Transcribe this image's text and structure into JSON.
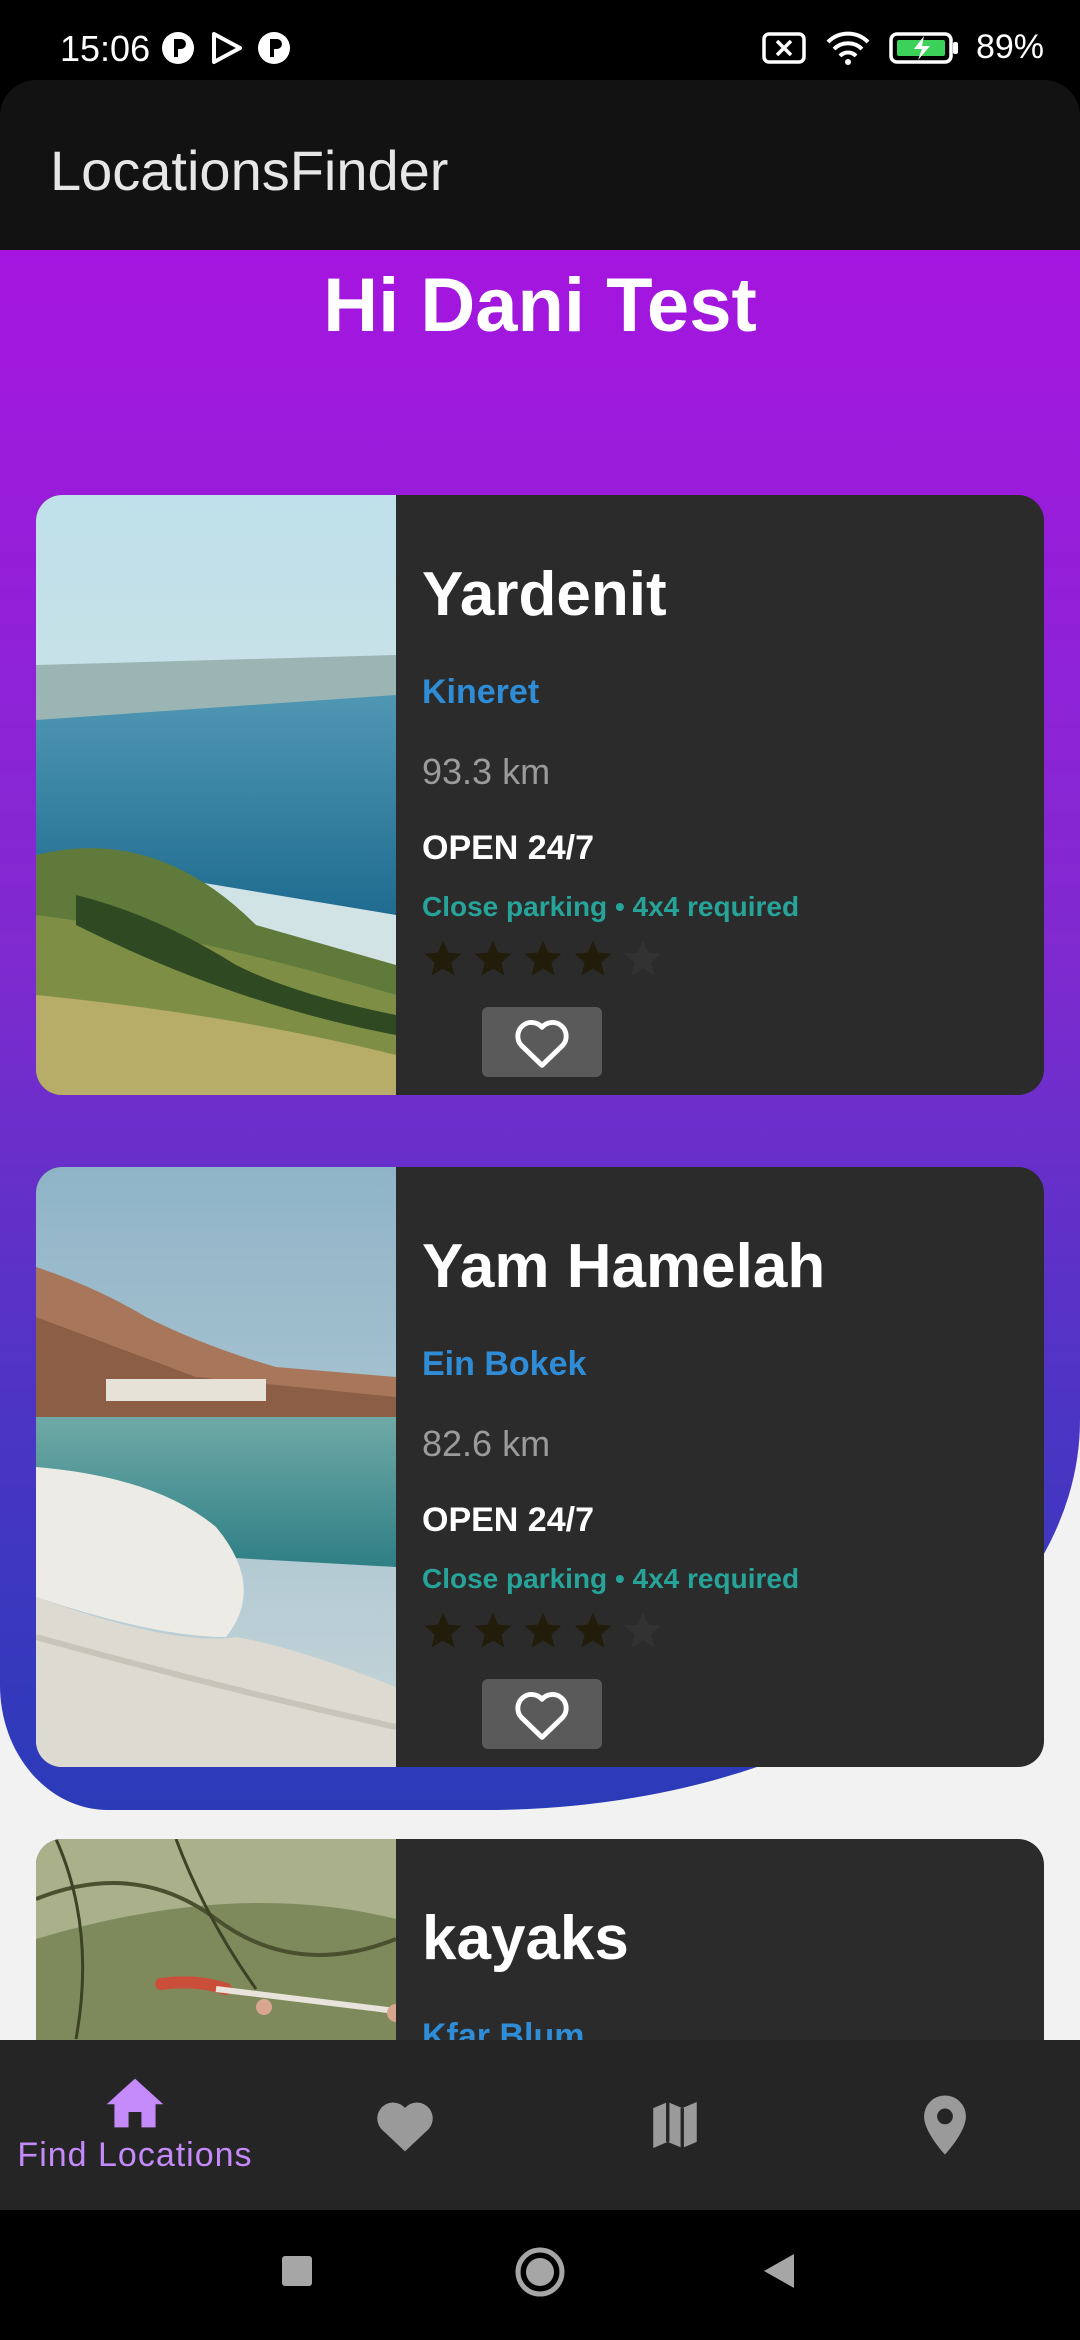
{
  "status_bar": {
    "time": "15:06",
    "battery": "89%",
    "icons": [
      "p-circle-icon",
      "play-store-icon",
      "p-circle-icon",
      "no-sim-icon",
      "wifi-icon",
      "battery-charging-icon"
    ]
  },
  "app_bar": {
    "title": "LocationsFinder"
  },
  "greeting": "Hi Dani Test",
  "locations": [
    {
      "name": "Yardenit",
      "area": "Kineret",
      "distance": "93.3 km",
      "hours": "OPEN 24/7",
      "notes": "Close parking • 4x4 required",
      "rating": 4,
      "max_rating": 5,
      "image": "sea-of-galilee-photo"
    },
    {
      "name": "Yam Hamelah",
      "area": "Ein Bokek",
      "distance": "82.6 km",
      "hours": "OPEN 24/7",
      "notes": "Close parking • 4x4 required",
      "rating": 4,
      "max_rating": 5,
      "image": "dead-sea-salt-photo"
    },
    {
      "name": "kayaks",
      "area": "Kfar Blum",
      "image": "kayak-photo"
    }
  ],
  "bottom_nav": {
    "items": [
      {
        "label": "Find Locations",
        "icon": "home-icon",
        "active": true
      },
      {
        "label": "",
        "icon": "heart-icon",
        "active": false
      },
      {
        "label": "",
        "icon": "map-icon",
        "active": false
      },
      {
        "label": "",
        "icon": "location-pin-icon",
        "active": false
      }
    ]
  },
  "colors": {
    "accent": "#c58af9",
    "area_link": "#2f8cd6",
    "notes": "#27a49a",
    "gradient_top": "#a515df",
    "gradient_bottom": "#2a3bb8"
  }
}
